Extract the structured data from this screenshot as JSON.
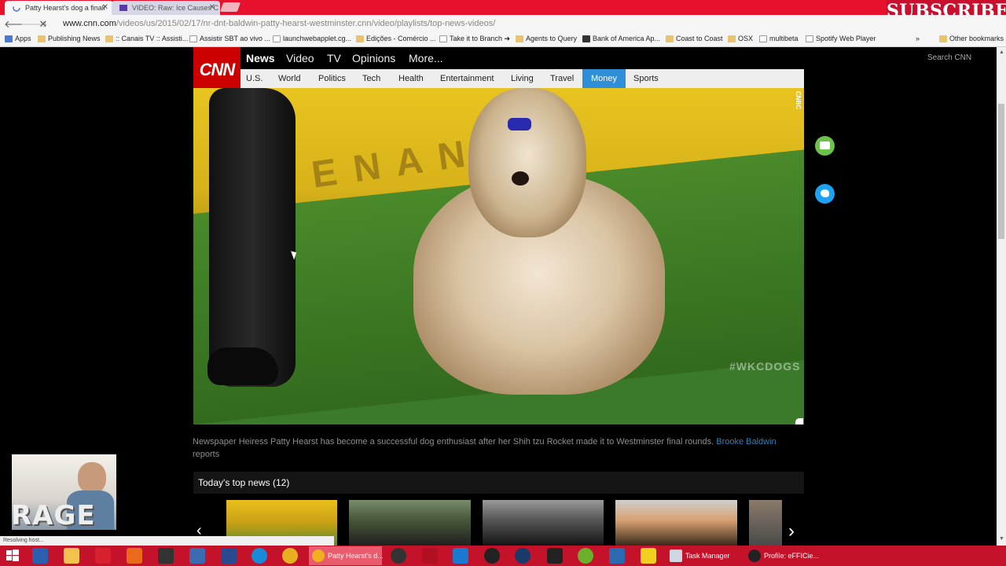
{
  "browser": {
    "tabs": [
      {
        "title": "Patty Hearst's dog a finali",
        "active": true
      },
      {
        "title": "VIDEO: Raw: Ice Causes C",
        "active": false
      }
    ],
    "url_host": "www.cnn.com",
    "url_path": "/videos/us/2015/02/17/nr-dnt-baldwin-patty-hearst-westminster.cnn/video/playlists/top-news-videos/",
    "bookmarks": [
      "Apps",
      "Publishing News",
      ":: Canais TV :: Assisti...",
      "Assistir SBT ao vivo ...",
      "launchwebapplet.cg...",
      "Edições - Comércio ...",
      "Take it to Branch ➜",
      "Agents to Query",
      "Bank of America Ap...",
      "Coast to Coast",
      "OSX",
      "multibeta",
      "Spotify Web Player",
      "»",
      "Other bookmarks"
    ],
    "status_text": "Resolving host..."
  },
  "overlay": {
    "subscribe": "SUBSCRIBE",
    "webcam_text": "RAGE"
  },
  "cnn": {
    "logo": "CNN",
    "topnav": [
      "News",
      "Video",
      "TV",
      "Opinions",
      "More..."
    ],
    "search_placeholder": "Search CNN",
    "subnav": [
      "U.S.",
      "World",
      "Politics",
      "Tech",
      "Health",
      "Entertainment",
      "Living",
      "Travel",
      "Money",
      "Sports"
    ],
    "subnav_active": "Money"
  },
  "video": {
    "watermark_network": "CNBC",
    "watermark_hashtag": "#WKCDOGS"
  },
  "caption": {
    "text": "Newspaper Heiress Patty Hearst has become a successful dog enthusiast after her Shih tzu Rocket made it to Westminster final rounds. ",
    "author": "Brooke Baldwin",
    "suffix": "reports"
  },
  "top_news": {
    "title": "Today's top news (12)"
  },
  "taskbar": {
    "apps": [
      {
        "label": "Patty Hearst's d..."
      },
      {
        "label": "Task Manager"
      },
      {
        "label": "Profile: eFFICie..."
      }
    ]
  }
}
